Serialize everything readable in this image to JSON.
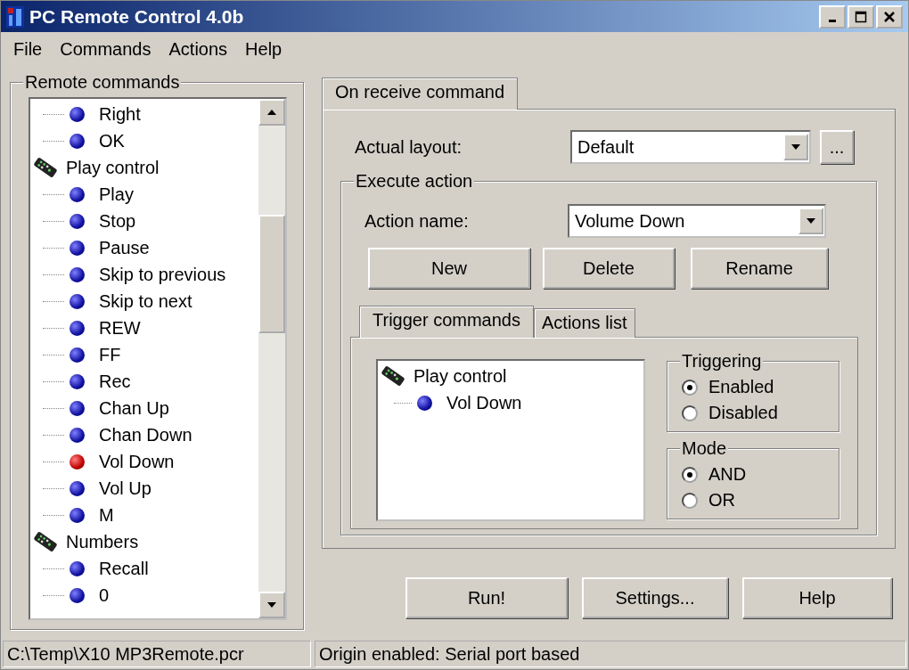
{
  "window": {
    "title": "PC Remote Control 4.0b"
  },
  "menu": [
    "File",
    "Commands",
    "Actions",
    "Help"
  ],
  "remote_commands": {
    "title": "Remote commands",
    "groups": [
      {
        "children": [
          {
            "label": "Right",
            "selected": false
          },
          {
            "label": "OK",
            "selected": false
          }
        ]
      },
      {
        "label": "Play control",
        "children": [
          {
            "label": "Play",
            "selected": false
          },
          {
            "label": "Stop",
            "selected": false
          },
          {
            "label": "Pause",
            "selected": false
          },
          {
            "label": "Skip to previous",
            "selected": false
          },
          {
            "label": "Skip to next",
            "selected": false
          },
          {
            "label": "REW",
            "selected": false
          },
          {
            "label": "FF",
            "selected": false
          },
          {
            "label": "Rec",
            "selected": false
          },
          {
            "label": "Chan Up",
            "selected": false
          },
          {
            "label": "Chan Down",
            "selected": false
          },
          {
            "label": "Vol Down",
            "selected": true
          },
          {
            "label": "Vol Up",
            "selected": false
          },
          {
            "label": "M",
            "selected": false
          }
        ]
      },
      {
        "label": "Numbers",
        "children": [
          {
            "label": "Recall",
            "selected": false
          },
          {
            "label": "0",
            "selected": false
          }
        ]
      }
    ]
  },
  "tabs": [
    {
      "label": "On receive command",
      "selected": true
    }
  ],
  "actual_layout": {
    "label": "Actual layout:",
    "value": "Default",
    "browse": "..."
  },
  "execute_action": {
    "title": "Execute action",
    "action_name": {
      "label": "Action name:",
      "value": "Volume Down"
    },
    "buttons": [
      "New",
      "Delete",
      "Rename"
    ],
    "tabs": [
      {
        "label": "Trigger commands",
        "selected": true
      },
      {
        "label": "Actions list",
        "selected": false
      }
    ],
    "trigger_tree": [
      {
        "label": "Play control",
        "children": [
          {
            "label": "Vol Down"
          }
        ]
      }
    ],
    "triggering": {
      "title": "Triggering",
      "options": [
        {
          "label": "Enabled",
          "selected": true
        },
        {
          "label": "Disabled",
          "selected": false
        }
      ]
    },
    "mode": {
      "title": "Mode",
      "options": [
        {
          "label": "AND",
          "selected": true
        },
        {
          "label": "OR",
          "selected": false
        }
      ]
    }
  },
  "buttons": [
    "Run!",
    "Settings...",
    "Help"
  ],
  "status_bar": [
    "C:\\Temp\\X10 MP3Remote.pcr",
    "Origin enabled: Serial port based"
  ]
}
